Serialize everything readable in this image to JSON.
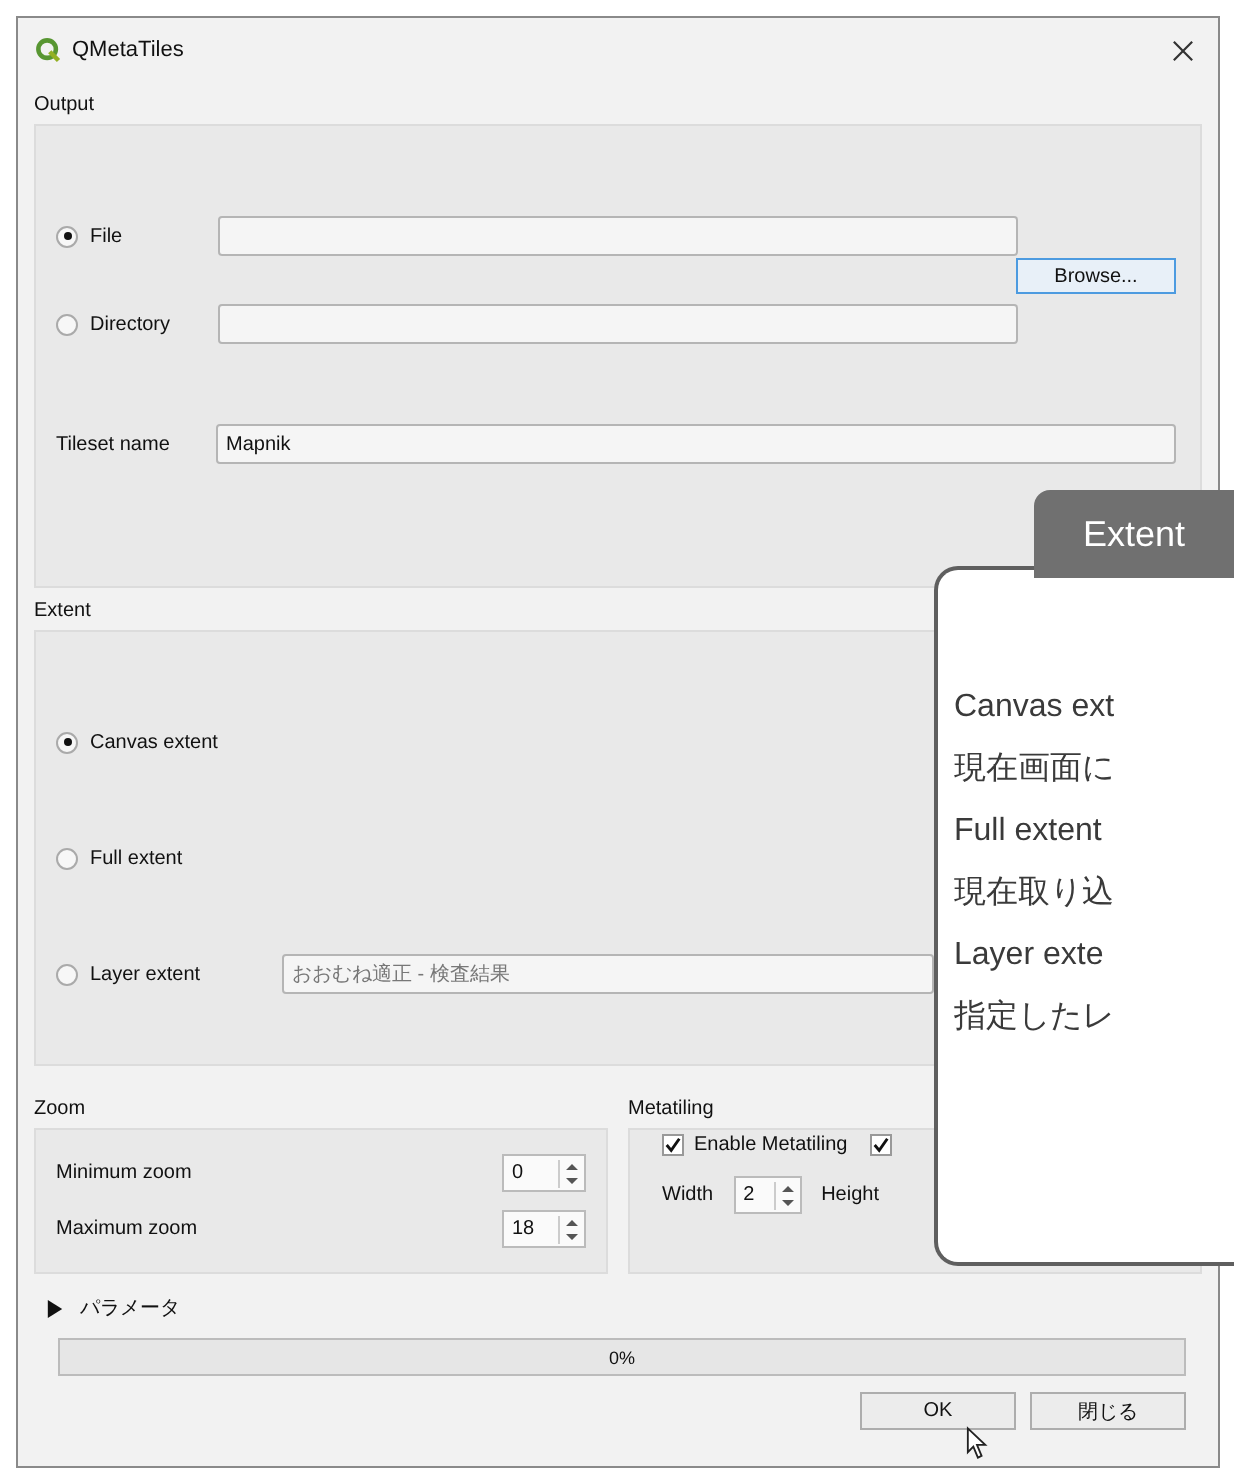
{
  "window": {
    "title": "QMetaTiles"
  },
  "output": {
    "title": "Output",
    "options": [
      {
        "label": "File",
        "selected": true
      },
      {
        "label": "Directory",
        "selected": false
      }
    ],
    "browse_button": "Browse...",
    "tileset_name": {
      "label": "Tileset name",
      "value": "Mapnik"
    }
  },
  "extent": {
    "title": "Extent",
    "options": [
      {
        "label": "Canvas extent",
        "selected": true
      },
      {
        "label": "Full extent",
        "selected": false
      },
      {
        "label": "Layer extent",
        "selected": false
      }
    ],
    "layer_field": {
      "value": "おおむね適正 - 検査結果",
      "disabled": true
    }
  },
  "zoom": {
    "title": "Zoom",
    "fields": [
      {
        "label": "Minimum zoom",
        "value": "0"
      },
      {
        "label": "Maximum zoom",
        "value": "18"
      }
    ]
  },
  "metatiling": {
    "title": "Metatiling",
    "checkboxes": [
      {
        "label": "Enable Metatiling",
        "checked": true
      },
      {
        "checked": true
      }
    ],
    "width": {
      "label": "Width",
      "value": "2"
    },
    "height_label": "Height"
  },
  "parameters": {
    "label": "パラメータ",
    "expanded": false
  },
  "progress": {
    "level": 0,
    "text": "0%"
  },
  "buttons": [
    "OK",
    "閉じる"
  ],
  "callout": {
    "title": "Extent",
    "lines": [
      "Canvas ext",
      "現在画面に",
      "Full extent",
      "現在取り込",
      "Layer exte",
      "指定したレ"
    ]
  }
}
